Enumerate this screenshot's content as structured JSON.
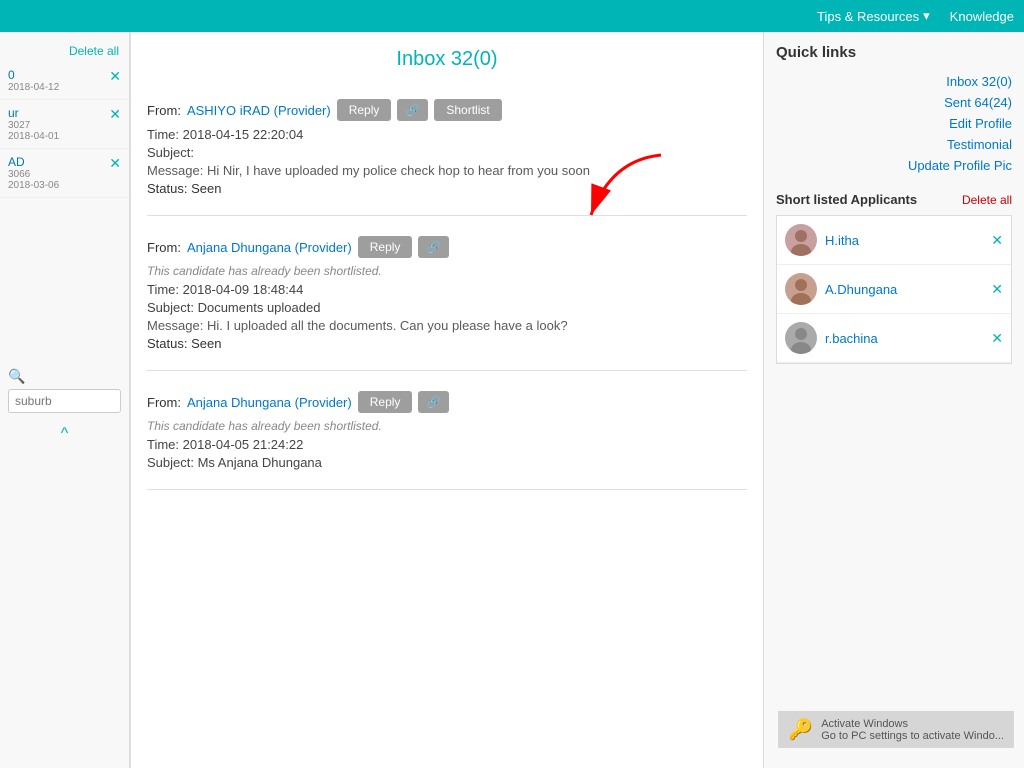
{
  "topNav": {
    "items": [
      {
        "label": "Tips & Resources",
        "hasChevron": true
      },
      {
        "label": "Knowledge"
      }
    ]
  },
  "leftSidebar": {
    "deleteAllLabel": "Delete all",
    "items": [
      {
        "name": "0",
        "date": "2018-04-12"
      },
      {
        "name": "ur",
        "date": "2018-04-01",
        "id": "3027"
      },
      {
        "name": "AD",
        "date": "2018-03-06",
        "id": "3066"
      }
    ],
    "searchPlaceholder": "suburb",
    "collapseIcon": "^"
  },
  "inbox": {
    "title": "Inbox 32(0)",
    "messages": [
      {
        "id": "msg1",
        "fromLabel": "From:",
        "fromName": "ASHIYO iRAD (Provider)",
        "hasReply": true,
        "hasLink": true,
        "hasShortlist": true,
        "replyLabel": "Reply",
        "shortlistLabel": "Shortlist",
        "time": "Time: 2018-04-15 22:20:04",
        "subject": "Subject:",
        "message": "Message: Hi Nir, I have uploaded my police check hop to hear from you soon",
        "status": "Status: Seen",
        "shortlistNote": null
      },
      {
        "id": "msg2",
        "fromLabel": "From:",
        "fromName": "Anjana Dhungana (Provider)",
        "hasReply": true,
        "hasLink": true,
        "hasShortlist": false,
        "replyLabel": "Reply",
        "shortlistLabel": null,
        "time": "Time: 2018-04-09 18:48:44",
        "subject": "Subject: Documents uploaded",
        "message": "Message: Hi. I uploaded all the documents. Can you please have a look?",
        "status": "Status: Seen",
        "shortlistNote": "This candidate has already been shortlisted."
      },
      {
        "id": "msg3",
        "fromLabel": "From:",
        "fromName": "Anjana Dhungana (Provider)",
        "hasReply": true,
        "hasLink": true,
        "hasShortlist": false,
        "replyLabel": "Reply",
        "shortlistLabel": null,
        "time": "Time: 2018-04-05 21:24:22",
        "subject": "Subject: Ms Anjana Dhungana",
        "message": null,
        "status": null,
        "shortlistNote": "This candidate has already been shortlisted."
      }
    ]
  },
  "quickLinks": {
    "title": "Quick links",
    "links": [
      {
        "label": "Inbox 32(0)",
        "href": "#"
      },
      {
        "label": "Sent 64(24)",
        "href": "#"
      },
      {
        "label": "Edit Profile",
        "href": "#"
      },
      {
        "label": "Testimonial",
        "href": "#"
      },
      {
        "label": "Update Profile Pic",
        "href": "#"
      }
    ]
  },
  "shortlistedApplicants": {
    "title": "Short listed Applicants",
    "deleteAllLabel": "Delete all",
    "items": [
      {
        "name": "H.itha",
        "hasPhoto": true,
        "photoType": "female1"
      },
      {
        "name": "A.Dhungana",
        "hasPhoto": true,
        "photoType": "female2"
      },
      {
        "name": "r.bachina",
        "hasPhoto": false,
        "photoType": "gray"
      }
    ]
  },
  "windowsActivation": {
    "line1": "Activate Windows",
    "line2": "Go to PC settings to activate Windo..."
  }
}
